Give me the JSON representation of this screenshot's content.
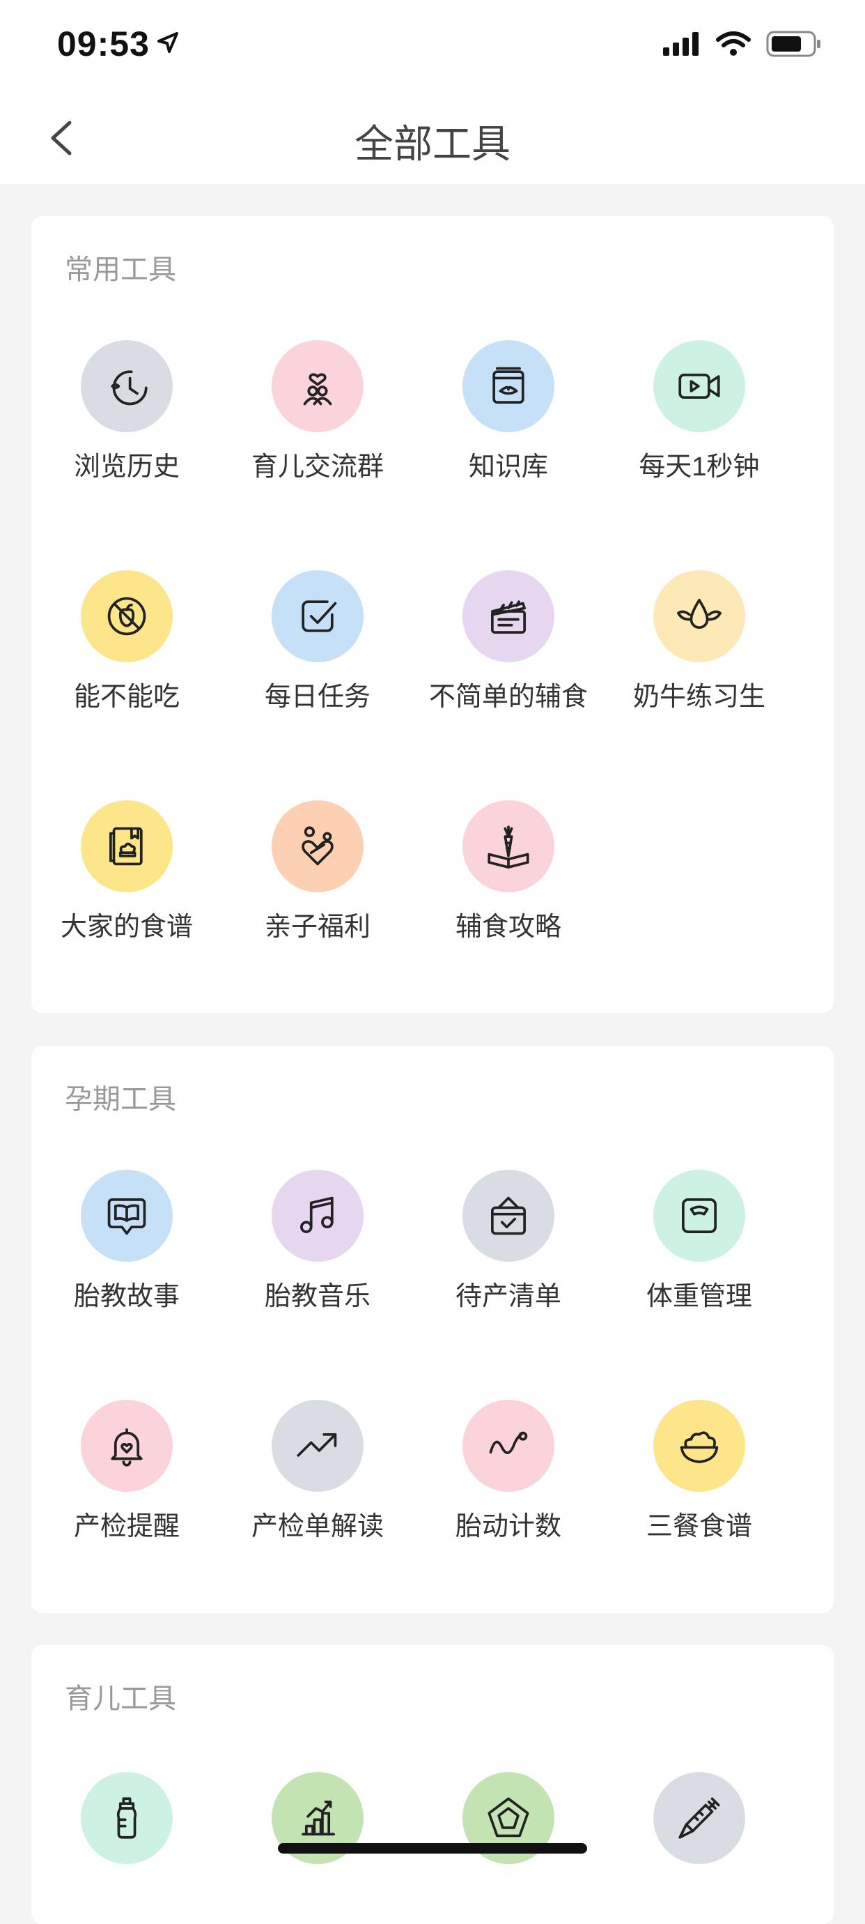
{
  "status_bar": {
    "time": "09:53"
  },
  "nav": {
    "title": "全部工具"
  },
  "sections": [
    {
      "title": "常用工具",
      "tools": [
        {
          "label": "浏览历史",
          "icon": "history-clock-icon",
          "color": "#d9dde3"
        },
        {
          "label": "育儿交流群",
          "icon": "parent-group-heart-icon",
          "color": "#fbd3da"
        },
        {
          "label": "知识库",
          "icon": "knowledge-book-icon",
          "color": "#c5e0f7"
        },
        {
          "label": "每天1秒钟",
          "icon": "video-camera-icon",
          "color": "#cdf2e4"
        },
        {
          "label": "能不能吃",
          "icon": "no-food-icon",
          "color": "#fde58a"
        },
        {
          "label": "每日任务",
          "icon": "checkbox-task-icon",
          "color": "#c5e0f7"
        },
        {
          "label": "不简单的辅食",
          "icon": "clapperboard-icon",
          "color": "#e7d6ef"
        },
        {
          "label": "奶牛练习生",
          "icon": "winged-drop-icon",
          "color": "#fde9b5"
        },
        {
          "label": "大家的食谱",
          "icon": "recipe-book-icon",
          "color": "#fde58a"
        },
        {
          "label": "亲子福利",
          "icon": "heart-gift-icon",
          "color": "#fdd0b2"
        },
        {
          "label": "辅食攻略",
          "icon": "carrot-book-icon",
          "color": "#fbd3da"
        }
      ]
    },
    {
      "title": "孕期工具",
      "tools": [
        {
          "label": "胎教故事",
          "icon": "story-book-bubble-icon",
          "color": "#c5e0f7"
        },
        {
          "label": "胎教音乐",
          "icon": "music-note-icon",
          "color": "#e7d6ef"
        },
        {
          "label": "待产清单",
          "icon": "checklist-bag-icon",
          "color": "#d9dde3"
        },
        {
          "label": "体重管理",
          "icon": "scale-icon",
          "color": "#cdf2e4"
        },
        {
          "label": "产检提醒",
          "icon": "bell-heart-icon",
          "color": "#fbd3da"
        },
        {
          "label": "产检单解读",
          "icon": "trend-arrow-icon",
          "color": "#d9dde3"
        },
        {
          "label": "胎动计数",
          "icon": "wave-line-icon",
          "color": "#fbd3da"
        },
        {
          "label": "三餐食谱",
          "icon": "salad-bowl-icon",
          "color": "#fde58a"
        }
      ]
    },
    {
      "title": "育儿工具",
      "tools": [
        {
          "label": "",
          "icon": "baby-bottle-icon",
          "color": "#cdf2e4"
        },
        {
          "label": "",
          "icon": "growth-chart-icon",
          "color": "#c3e3b2"
        },
        {
          "label": "",
          "icon": "pentagon-icon",
          "color": "#c3e3b2"
        },
        {
          "label": "",
          "icon": "syringe-icon",
          "color": "#d9dde3"
        }
      ]
    }
  ]
}
